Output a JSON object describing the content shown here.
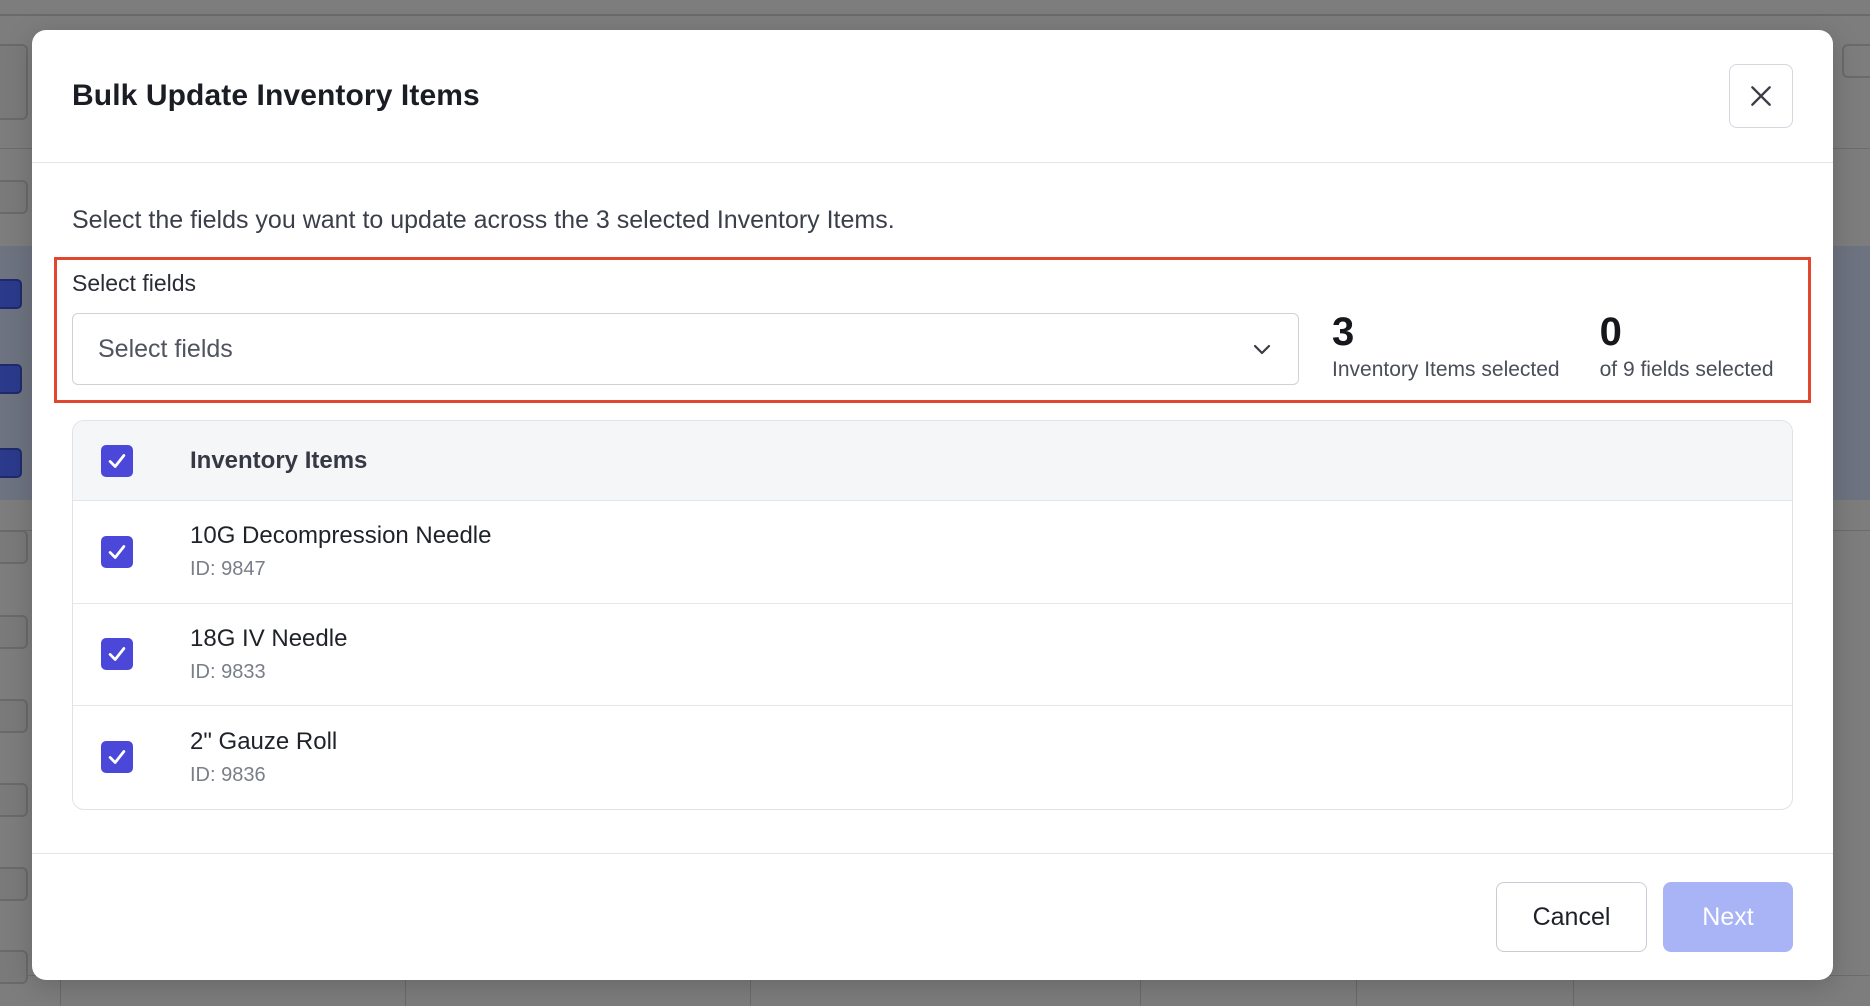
{
  "modal": {
    "title": "Bulk Update Inventory Items",
    "description": "Select the fields you want to update across the 3 selected Inventory Items."
  },
  "field_select": {
    "label": "Select fields",
    "placeholder": "Select fields"
  },
  "stats": {
    "items_selected": {
      "value": "3",
      "label": "Inventory Items selected"
    },
    "fields_selected": {
      "value": "0",
      "label": "of 9 fields selected"
    }
  },
  "table": {
    "header": "Inventory Items",
    "header_checked": true,
    "rows": [
      {
        "name": "10G Decompression Needle",
        "id": "ID: 9847",
        "checked": true
      },
      {
        "name": "18G IV Needle",
        "id": "ID: 9833",
        "checked": true
      },
      {
        "name": "2\" Gauze Roll",
        "id": "ID: 9836",
        "checked": true
      }
    ]
  },
  "footer": {
    "cancel_label": "Cancel",
    "next_label": "Next",
    "next_enabled": false
  },
  "icons": {
    "close": "close-icon",
    "dropdown": "chevron-down-icon",
    "check": "checkmark-icon"
  },
  "colors": {
    "accent": "#4b47d8",
    "next_disabled": "#a8b4f5",
    "highlight_border": "#e2462f"
  }
}
